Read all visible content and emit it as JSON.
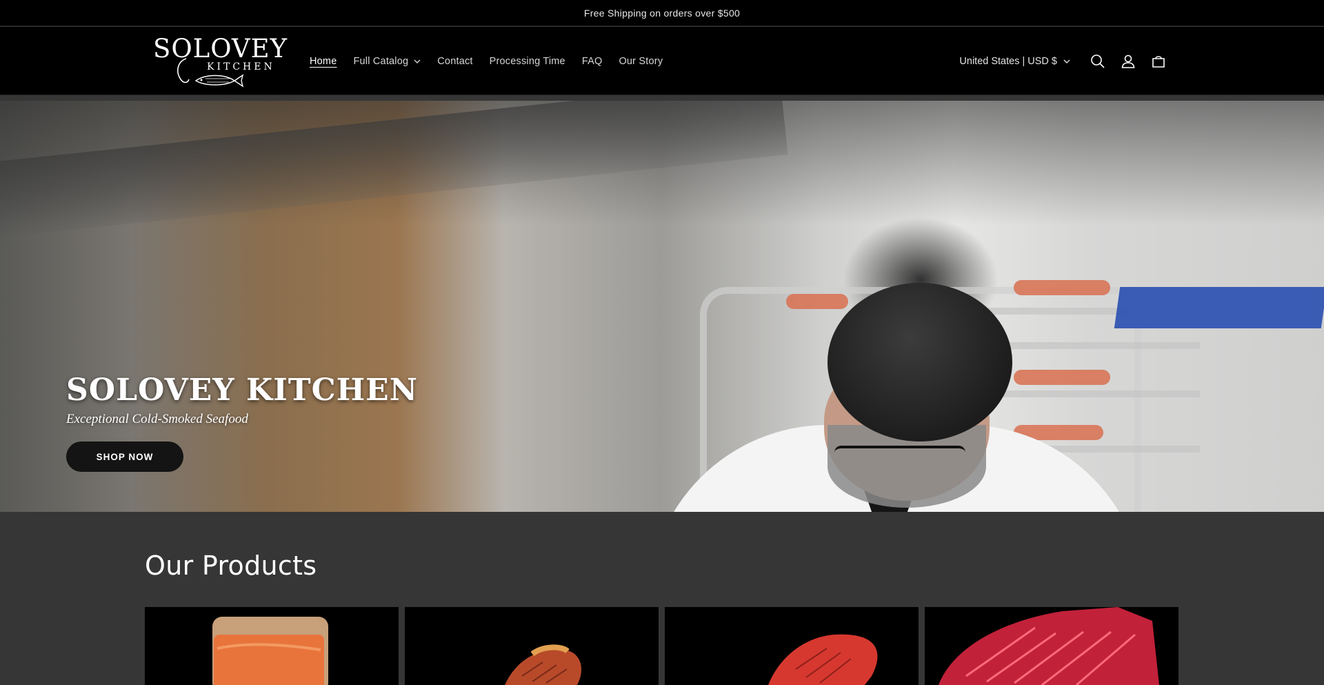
{
  "announcement": {
    "text": "Free Shipping on orders over $500"
  },
  "header": {
    "logo": {
      "title": "SOLOVEY",
      "subtitle": "KITCHEN"
    },
    "nav": [
      {
        "label": "Home",
        "active": true
      },
      {
        "label": "Full Catalog",
        "has_dropdown": true
      },
      {
        "label": "Contact"
      },
      {
        "label": "Processing Time"
      },
      {
        "label": "FAQ"
      },
      {
        "label": "Our Story"
      }
    ],
    "locale": "United States | USD $",
    "icons": [
      "search-icon",
      "account-icon",
      "cart-icon"
    ]
  },
  "hero": {
    "title": "SOLOVEY KITCHEN",
    "subtitle": "Exceptional Cold-Smoked Seafood",
    "button": "SHOP NOW"
  },
  "products_section": {
    "title": "Our Products",
    "products": [
      {
        "image": "smoked-salmon-slices-image"
      },
      {
        "image": "smoked-fish-fillet-image"
      },
      {
        "image": "red-fish-fillet-image"
      },
      {
        "image": "sliced-red-fish-image"
      }
    ]
  },
  "colors": {
    "header_bg": "#000000",
    "page_bg": "#363636",
    "button_bg": "#141414",
    "text": "#ffffff"
  }
}
